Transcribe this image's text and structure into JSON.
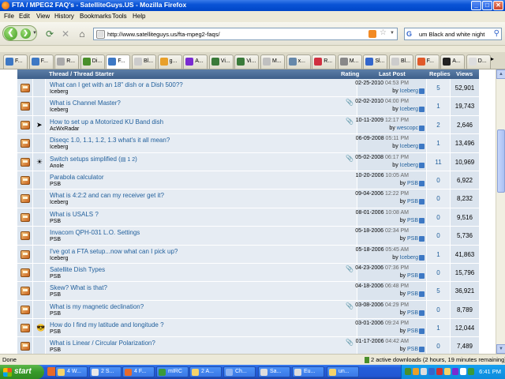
{
  "window": {
    "title": "FTA / MPEG2 FAQ's - SatelliteGuys.US - Mozilla Firefox",
    "buttons": {
      "minimize": "_",
      "maximize": "□",
      "close": "✕"
    }
  },
  "menu": [
    "File",
    "Edit",
    "View",
    "History",
    "Bookmarks",
    "Tools",
    "Help"
  ],
  "nav": {
    "url": "http://www.satelliteguys.us/fta-mpeg2-faqs/",
    "search_value": "um Black and white night"
  },
  "tabs": [
    {
      "label": "F...",
      "color": "#3d78c4"
    },
    {
      "label": "F...",
      "color": "#3d78c4"
    },
    {
      "label": "R...",
      "color": "#aaaaaa"
    },
    {
      "label": "Di...",
      "color": "#4a8f2a"
    },
    {
      "label": "F...",
      "color": "#3d78c4",
      "active": true
    },
    {
      "label": "Bl...",
      "color": "#cccccc"
    },
    {
      "label": "g...",
      "color": "#e8a02a"
    },
    {
      "label": "A...",
      "color": "#7a2bd1"
    },
    {
      "label": "Vi...",
      "color": "#3a7a3a"
    },
    {
      "label": "Vi...",
      "color": "#3a7a3a"
    },
    {
      "label": "M...",
      "color": "#c0c0c0"
    },
    {
      "label": "x...",
      "color": "#6688aa"
    },
    {
      "label": "R...",
      "color": "#d03040"
    },
    {
      "label": "M...",
      "color": "#888888"
    },
    {
      "label": "Sl...",
      "color": "#3366cc"
    },
    {
      "label": "Bl...",
      "color": "#cccccc"
    },
    {
      "label": "F...",
      "color": "#e05a2a"
    },
    {
      "label": "A...",
      "color": "#222222"
    },
    {
      "label": "D...",
      "color": "#dddddd"
    }
  ],
  "table": {
    "headers": {
      "thread": "Thread / Thread Starter",
      "rating": "Rating",
      "last_post": "Last Post",
      "replies": "Replies",
      "views": "Views"
    },
    "rows": [
      {
        "title": "What can I get with an 18\" dish or a Dish 500??",
        "starter": "Iceberg",
        "attach": false,
        "date": "02-25-2010",
        "time": "04:53 PM",
        "by": "Iceberg",
        "replies": "5",
        "views": "52,901",
        "icon": ""
      },
      {
        "title": "What is Channel Master?",
        "starter": "Iceberg",
        "attach": true,
        "date": "02-02-2010",
        "time": "04:00 PM",
        "by": "Iceberg",
        "replies": "1",
        "views": "19,743",
        "icon": ""
      },
      {
        "title": "How to set up a Motorized KU Band dish",
        "starter": "AcWxRadar",
        "attach": true,
        "date": "10-11-2009",
        "time": "12:17 PM",
        "by": "wescopc",
        "replies": "2",
        "views": "2,646",
        "icon": "➤"
      },
      {
        "title": "Diseqc 1.0, 1.1, 1.2, 1.3 what's it all mean?",
        "starter": "Iceberg",
        "attach": false,
        "date": "06-09-2008",
        "time": "05:11 PM",
        "by": "Iceberg",
        "replies": "1",
        "views": "13,496",
        "icon": ""
      },
      {
        "title": "Switch setups simplified (",
        "pages": "1 2",
        "title_end": ")",
        "starter": "Anole",
        "attach": true,
        "date": "05-02-2008",
        "time": "06:17 PM",
        "by": "Iceberg",
        "replies": "11",
        "views": "10,969",
        "icon": "☀"
      },
      {
        "title": "Parabola calculator",
        "starter": "PSB",
        "attach": false,
        "date": "10-20-2006",
        "time": "10:05 AM",
        "by": "PSB",
        "replies": "0",
        "views": "6,922",
        "icon": ""
      },
      {
        "title": "What is 4:2:2 and can my receiver get it?",
        "starter": "Iceberg",
        "attach": false,
        "date": "09-04-2006",
        "time": "12:22 PM",
        "by": "PSB",
        "replies": "0",
        "views": "8,232",
        "icon": ""
      },
      {
        "title": "What is USALS ?",
        "starter": "PSB",
        "attach": false,
        "date": "08-01-2006",
        "time": "10:08 AM",
        "by": "PSB",
        "replies": "0",
        "views": "9,516",
        "icon": ""
      },
      {
        "title": "Invacom QPH-031 L.O. Settings",
        "starter": "PSB",
        "attach": false,
        "date": "05-18-2006",
        "time": "02:34 PM",
        "by": "PSB",
        "replies": "0",
        "views": "5,736",
        "icon": ""
      },
      {
        "title": "I've got a FTA setup...now what can I pick up?",
        "starter": "Iceberg",
        "attach": false,
        "date": "05-18-2006",
        "time": "05:45 AM",
        "by": "Iceberg",
        "replies": "1",
        "views": "41,863",
        "icon": ""
      },
      {
        "title": "Satellite Dish Types",
        "starter": "PSB",
        "attach": true,
        "date": "04-23-2006",
        "time": "07:36 PM",
        "by": "PSB",
        "replies": "0",
        "views": "15,796",
        "icon": ""
      },
      {
        "title": "Skew? What is that?",
        "starter": "PSB",
        "attach": false,
        "date": "04-18-2006",
        "time": "06:48 PM",
        "by": "PSB",
        "replies": "5",
        "views": "36,921",
        "icon": ""
      },
      {
        "title": "What is my magnetic declination?",
        "starter": "PSB",
        "attach": true,
        "date": "03-08-2006",
        "time": "04:29 PM",
        "by": "PSB",
        "replies": "0",
        "views": "8,789",
        "icon": ""
      },
      {
        "title": "How do I find my latitude and longitude ?",
        "starter": "PSB",
        "attach": false,
        "date": "03-01-2006",
        "time": "09:24 PM",
        "by": "PSB",
        "replies": "1",
        "views": "12,044",
        "icon": "😎"
      },
      {
        "title": "What is Linear / Circular Polarization?",
        "starter": "PSB",
        "attach": true,
        "date": "01-17-2006",
        "time": "04:42 AM",
        "by": "PSB",
        "replies": "0",
        "views": "7,489",
        "icon": ""
      }
    ]
  },
  "status": {
    "left": "Done",
    "downloads": "2 active downloads (2 hours, 19 minutes remaining)"
  },
  "taskbar": {
    "start": "start",
    "buttons": [
      {
        "label": "4 W...",
        "color": "#f5d36a"
      },
      {
        "label": "2 S...",
        "color": "#e8e8e8"
      },
      {
        "label": "4 F...",
        "color": "#e86a2a"
      },
      {
        "label": "mIRC",
        "color": "#3a9a3a"
      },
      {
        "label": "2 A...",
        "color": "#f5d36a"
      },
      {
        "label": "Ch...",
        "color": "#8fb3f0"
      },
      {
        "label": "Sa...",
        "color": "#dddddd"
      },
      {
        "label": "Eu...",
        "color": "#dddddd"
      },
      {
        "label": "un...",
        "color": "#f5d36a"
      }
    ],
    "clock": "6:41 PM"
  }
}
